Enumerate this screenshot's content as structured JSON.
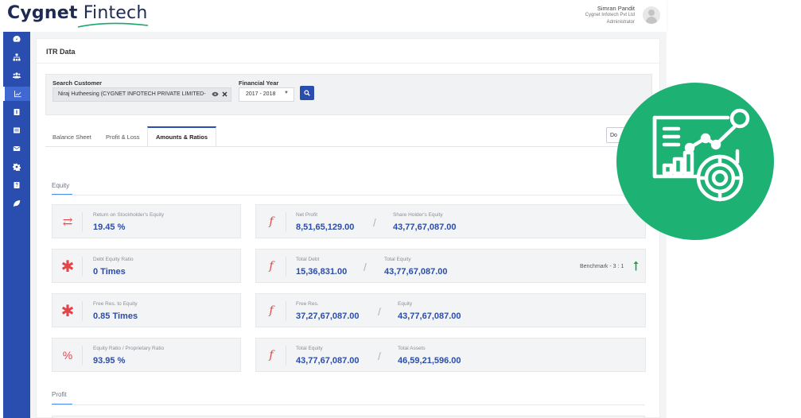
{
  "brand": {
    "name_bold": "Cygnet",
    "name_light": "Fintech"
  },
  "user": {
    "name": "Simran Pandit",
    "company": "Cygnet Infotech Pvt Ltd",
    "role": "Administrator"
  },
  "sidebar": {
    "items": [
      {
        "icon": "dashboard-icon"
      },
      {
        "icon": "sitemap-icon"
      },
      {
        "icon": "users-icon"
      },
      {
        "icon": "chart-icon",
        "active": true
      },
      {
        "icon": "document-icon"
      },
      {
        "icon": "list-icon"
      },
      {
        "icon": "mail-icon"
      },
      {
        "icon": "gear-icon"
      },
      {
        "icon": "book-icon"
      },
      {
        "icon": "leaf-icon"
      }
    ]
  },
  "page": {
    "title": "ITR Data"
  },
  "search": {
    "customer_label": "Search Customer",
    "customer_value": "Niraj Hutheesing (CYGNET INFOTECH PRIVATE LIMITED-",
    "year_label": "Financial Year",
    "year_value": "2017 - 2018"
  },
  "tabs": [
    {
      "label": "Balance Sheet"
    },
    {
      "label": "Profit & Loss"
    },
    {
      "label": "Amounts & Ratios",
      "active": true
    }
  ],
  "download_button": "Do",
  "equity": {
    "heading": "Equity",
    "rows": [
      {
        "ratio_label": "Return on Stockholder's Equity",
        "ratio_value": "19.45 %",
        "ratio_icon": "⇄",
        "num_label": "Net Profit",
        "num_value": "8,51,65,129.00",
        "den_label": "Share Holder's Equity",
        "den_value": "43,77,67,087.00"
      },
      {
        "ratio_label": "Debt Equity Ratio",
        "ratio_value": "0 Times",
        "ratio_icon": "✱",
        "num_label": "Total Debt",
        "num_value": "15,36,831.00",
        "den_label": "Total Equity",
        "den_value": "43,77,67,087.00",
        "benchmark": "Benchmark - 3 : 1"
      },
      {
        "ratio_label": "Free Res. to Equity",
        "ratio_value": "0.85 Times",
        "ratio_icon": "✱",
        "num_label": "Free Res.",
        "num_value": "37,27,67,087.00",
        "den_label": "Equity",
        "den_value": "43,77,67,087.00"
      },
      {
        "ratio_label": "Equity Ratio / Proprietary Ratio",
        "ratio_value": "93.95 %",
        "ratio_icon": "%",
        "num_label": "Total Equity",
        "num_value": "43,77,67,087.00",
        "den_label": "Total Assets",
        "den_value": "46,59,21,596.00"
      }
    ]
  },
  "profit": {
    "heading": "Profit"
  },
  "formula_icon": "f",
  "slash": "/",
  "colors": {
    "brand_blue": "#2a4db0",
    "value_blue": "#2c4da7",
    "icon_red": "#e54349",
    "badge_green": "#1eb174"
  }
}
